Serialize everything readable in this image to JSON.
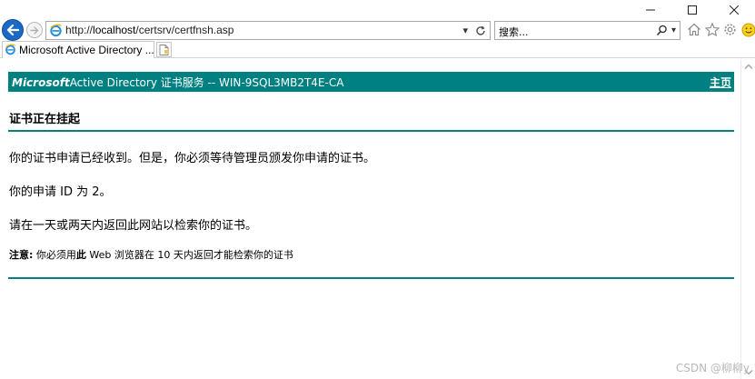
{
  "browser": {
    "address_url": "http://localhost/certsrv/certfnsh.asp",
    "search_placeholder": "搜索...",
    "tab_title": "Microsoft Active Directory ...",
    "tab_close": "×"
  },
  "page": {
    "brand": "Microsoft",
    "service_title": " Active Directory 证书服务  --  WIN-9SQL3MB2T4E-CA",
    "home_link": "主页",
    "heading": "证书正在挂起",
    "para1": "你的证书申请已经收到。但是，你必须等待管理员颁发你申请的证书。",
    "para2": "你的申请 ID 为 2。",
    "para3": "请在一天或两天内返回此网站以检索你的证书。",
    "note_label": "注意:",
    "note_pre": " 你必须用",
    "note_bold": "此",
    "note_post": " Web 浏览器在 10 天内返回才能检索你的证书"
  },
  "watermark": "CSDN @柳柳y",
  "colors": {
    "accent": "#008080",
    "back_button": "#1c69c5"
  }
}
